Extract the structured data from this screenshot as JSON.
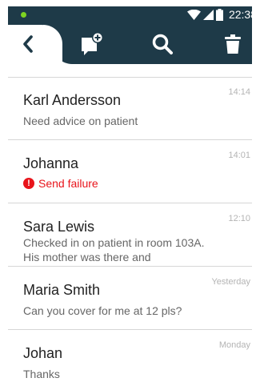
{
  "status_bar": {
    "time": "22:38",
    "icons": [
      "notification-dot-icon",
      "wifi-icon",
      "cell-signal-icon",
      "battery-icon"
    ],
    "dot_color": "#7ed321"
  },
  "toolbar": {
    "background": "#1e3a48",
    "actions": [
      "back-icon",
      "new-message-icon",
      "search-icon",
      "trash-icon"
    ]
  },
  "conversations": [
    {
      "name": "Karl Andersson",
      "time": "14:14",
      "preview": "Need advice on patient",
      "failed": false
    },
    {
      "name": "Johanna",
      "time": "14:01",
      "preview": "",
      "failed": true,
      "failure_text": "Send failure",
      "failure_icon": "!"
    },
    {
      "name": "Sara Lewis",
      "time": "12:10",
      "preview": "Checked in on patient in room 103A. His mother was there and",
      "failed": false
    },
    {
      "name": "Maria Smith",
      "time": "Yesterday",
      "preview": "Can you cover for me at 12 pls?",
      "failed": false
    },
    {
      "name": "Johan",
      "time": "Monday",
      "preview": "Thanks",
      "failed": false
    }
  ],
  "colors": {
    "error": "#e8141b",
    "timestamp": "#b4b4b4",
    "name": "#222222",
    "preview": "#666666"
  }
}
